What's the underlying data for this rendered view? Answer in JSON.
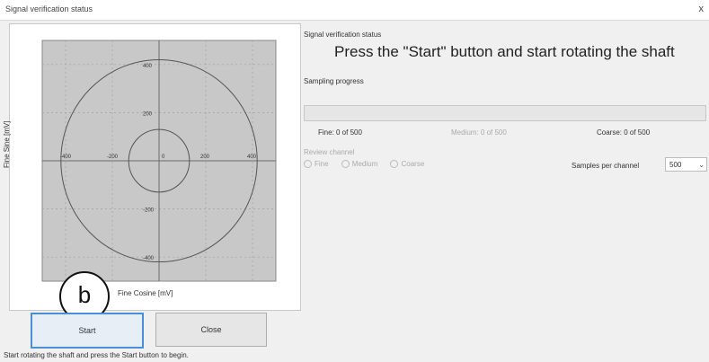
{
  "window": {
    "title": "Signal verification status",
    "close_glyph": "x"
  },
  "plot": {
    "x_axis_label": "Fine Cosine [mV]",
    "y_axis_label": "Fine Sine [mV]",
    "x_ticks": [
      "-400",
      "-200",
      "0",
      "200",
      "400"
    ],
    "y_ticks": [
      "400",
      "200",
      "0",
      "-200",
      "-400"
    ],
    "circles_mV": [
      {
        "cx": 0,
        "cy": 0,
        "r": 130
      },
      {
        "cx": 0,
        "cy": 0,
        "r": 420
      }
    ]
  },
  "marker": {
    "label": "b"
  },
  "buttons": {
    "start": "Start",
    "close": "Close"
  },
  "status_bar": {
    "text": "Start rotating the shaft and press the Start button to begin."
  },
  "right_panel": {
    "status_label": "Signal verification status",
    "instruction": "Press the \"Start\" button and start rotating the shaft",
    "sampling_label": "Sampling progress",
    "progress_percent": 0,
    "fine_count": "Fine: 0 of 500",
    "medium_count": "Medium: 0 of 500",
    "coarse_count": "Coarse: 0 of 500",
    "review_label": "Review channel",
    "review_options": [
      "Fine",
      "Medium",
      "Coarse"
    ],
    "samples_label": "Samples per channel",
    "samples_value": "500"
  },
  "colors": {
    "plot_bg": "#c8c8c8",
    "grid": "#a0a0a0",
    "axis": "#6b6b6b",
    "accent": "#4a90d9"
  }
}
